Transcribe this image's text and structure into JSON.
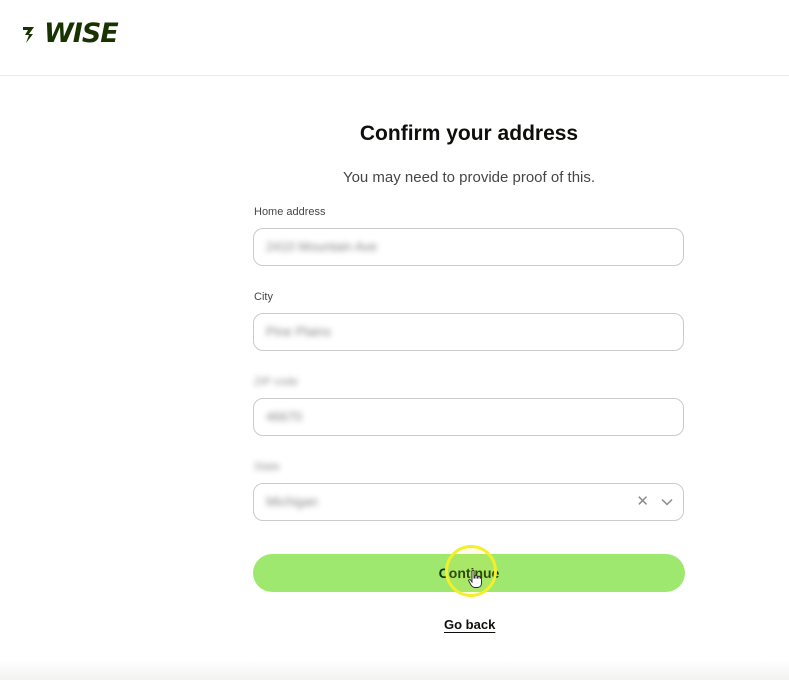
{
  "brand": {
    "name": "WISE",
    "logo_icon": "wise-flag-icon",
    "color": "#163300"
  },
  "page": {
    "title": "Confirm your address",
    "subtitle": "You may need to provide proof of this."
  },
  "form": {
    "home_address": {
      "label": "Home address",
      "value": "2410 Mountain Ave"
    },
    "city": {
      "label": "City",
      "value": "Pine Plains"
    },
    "zip": {
      "label": "ZIP code",
      "value": "46670"
    },
    "state": {
      "label": "State",
      "value": "Michigan",
      "clear_icon": "close-icon",
      "dropdown_icon": "chevron-down-icon"
    }
  },
  "actions": {
    "continue_label": "Continue",
    "go_back_label": "Go back"
  },
  "colors": {
    "primary_button": "#9fe870",
    "primary_text": "#163300",
    "cursor_highlight": "#f3ef2a"
  }
}
